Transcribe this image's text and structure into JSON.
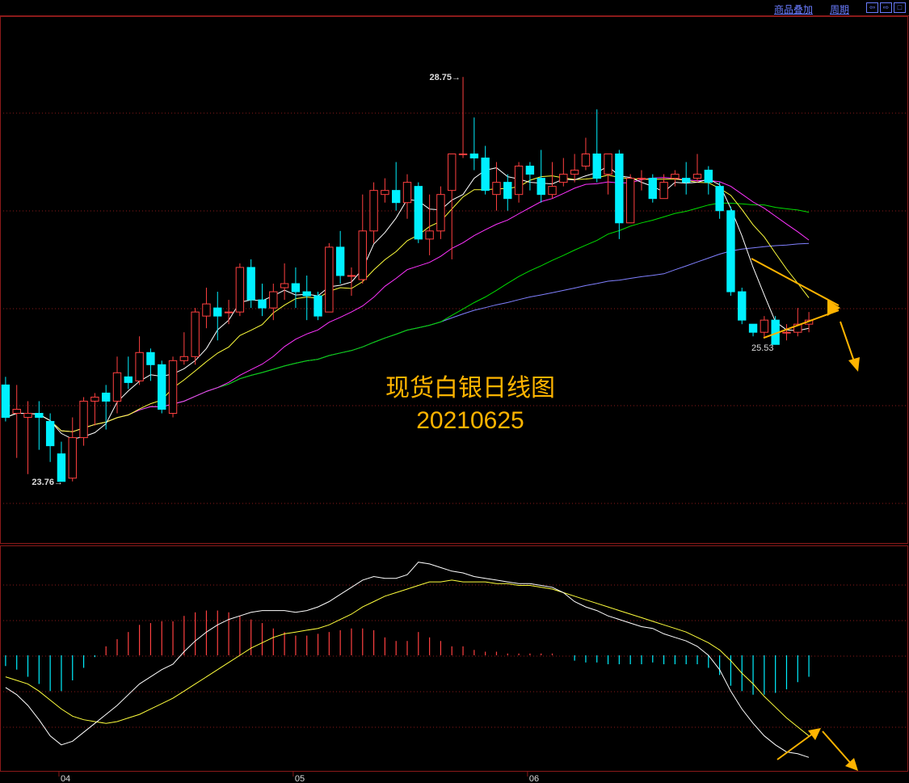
{
  "toolbar": {
    "overlay_label": "商品叠加",
    "period_label": "周期",
    "nav_icons": [
      "arrow-left-icon",
      "arrow-right-icon",
      "square-icon"
    ]
  },
  "colors": {
    "up": "#ff4040",
    "down": "#00f0ff",
    "ma5": "#ffffff",
    "ma10": "#ffff3c",
    "ma20": "#ff33ff",
    "ma40": "#00dd00",
    "ma60": "#8080ff",
    "grid": "#8b1a1a",
    "annotation": "#ffb400",
    "label": "#dddddd"
  },
  "chart_data": [
    {
      "type": "candlestick",
      "title": "现货白银日线图",
      "subtitle": "20210625",
      "x_tick_labels": [
        "04",
        "05",
        "06"
      ],
      "ylim": [
        23.0,
        29.5
      ],
      "high_marker": "28.75",
      "low_marker": "23.76",
      "annotation_low": "25.53",
      "candles": [
        [
          24.95,
          24.55,
          25.05,
          24.5
        ],
        [
          24.6,
          24.65,
          24.95,
          24.05
        ],
        [
          24.55,
          24.6,
          24.75,
          23.85
        ],
        [
          24.6,
          24.55,
          24.75,
          24.15
        ],
        [
          24.5,
          24.2,
          24.6,
          24.0
        ],
        [
          24.1,
          23.76,
          24.25,
          23.76
        ],
        [
          23.8,
          24.3,
          24.55,
          23.76
        ],
        [
          24.3,
          24.75,
          24.8,
          24.2
        ],
        [
          24.75,
          24.8,
          24.85,
          24.45
        ],
        [
          24.85,
          24.75,
          24.95,
          24.4
        ],
        [
          24.75,
          25.1,
          25.3,
          24.6
        ],
        [
          25.05,
          24.98,
          25.3,
          24.9
        ],
        [
          25.0,
          25.35,
          25.55,
          24.95
        ],
        [
          25.35,
          25.2,
          25.4,
          25.0
        ],
        [
          25.2,
          24.65,
          25.25,
          24.6
        ],
        [
          24.6,
          25.25,
          25.3,
          24.55
        ],
        [
          25.25,
          25.3,
          25.6,
          25.2
        ],
        [
          25.3,
          25.85,
          25.9,
          25.2
        ],
        [
          25.8,
          25.95,
          26.15,
          25.65
        ],
        [
          25.9,
          25.8,
          26.1,
          25.5
        ],
        [
          25.85,
          25.85,
          26.0,
          25.7
        ],
        [
          25.85,
          26.4,
          26.45,
          25.8
        ],
        [
          26.4,
          26.0,
          26.5,
          25.9
        ],
        [
          26.0,
          25.9,
          26.2,
          25.8
        ],
        [
          25.9,
          26.1,
          26.2,
          25.75
        ],
        [
          26.15,
          26.2,
          26.45,
          26.0
        ],
        [
          26.2,
          26.1,
          26.4,
          25.9
        ],
        [
          26.1,
          26.05,
          26.3,
          25.75
        ],
        [
          26.05,
          25.8,
          26.1,
          25.75
        ],
        [
          25.85,
          26.65,
          26.7,
          25.85
        ],
        [
          26.65,
          26.3,
          26.85,
          26.2
        ],
        [
          26.3,
          26.3,
          26.4,
          26.05
        ],
        [
          26.25,
          26.85,
          27.3,
          26.2
        ],
        [
          26.85,
          27.35,
          27.45,
          26.7
        ],
        [
          27.3,
          27.35,
          27.5,
          27.2
        ],
        [
          27.35,
          27.2,
          27.7,
          27.1
        ],
        [
          27.2,
          27.45,
          27.55,
          27.0
        ],
        [
          27.4,
          26.75,
          27.45,
          26.7
        ],
        [
          26.75,
          26.85,
          27.3,
          26.55
        ],
        [
          26.85,
          27.3,
          27.4,
          26.75
        ],
        [
          27.35,
          27.8,
          27.8,
          26.5
        ],
        [
          27.8,
          27.8,
          28.75,
          27.75
        ],
        [
          27.8,
          27.75,
          28.25,
          27.6
        ],
        [
          27.75,
          27.35,
          27.9,
          27.3
        ],
        [
          27.3,
          27.45,
          27.7,
          27.1
        ],
        [
          27.45,
          27.25,
          27.55,
          27.1
        ],
        [
          27.3,
          27.65,
          27.7,
          27.2
        ],
        [
          27.65,
          27.55,
          27.7,
          27.35
        ],
        [
          27.5,
          27.3,
          27.85,
          27.2
        ],
        [
          27.3,
          27.4,
          27.7,
          27.25
        ],
        [
          27.45,
          27.55,
          27.75,
          27.4
        ],
        [
          27.55,
          27.6,
          27.8,
          27.45
        ],
        [
          27.65,
          27.8,
          28.0,
          27.6
        ],
        [
          27.8,
          27.5,
          28.35,
          27.45
        ],
        [
          27.55,
          27.8,
          27.8,
          27.3
        ],
        [
          27.8,
          26.95,
          27.85,
          26.75
        ],
        [
          26.95,
          27.5,
          27.55,
          26.95
        ],
        [
          27.5,
          27.5,
          27.6,
          27.35
        ],
        [
          27.5,
          27.25,
          27.55,
          27.2
        ],
        [
          27.25,
          27.45,
          27.55,
          27.35
        ],
        [
          27.5,
          27.55,
          27.6,
          27.4
        ],
        [
          27.5,
          27.45,
          27.7,
          27.3
        ],
        [
          27.5,
          27.55,
          27.8,
          27.45
        ],
        [
          27.6,
          27.45,
          27.65,
          27.3
        ],
        [
          27.4,
          27.1,
          27.45,
          27.0
        ],
        [
          27.1,
          26.1,
          27.15,
          26.05
        ],
        [
          26.1,
          25.75,
          26.15,
          25.7
        ],
        [
          25.7,
          25.6,
          25.7,
          25.55
        ],
        [
          25.6,
          25.75,
          25.8,
          25.53
        ],
        [
          25.75,
          25.45,
          25.8,
          25.45
        ],
        [
          25.6,
          25.6,
          25.7,
          25.5
        ],
        [
          25.6,
          25.7,
          25.9,
          25.55
        ],
        [
          25.7,
          25.75,
          25.85,
          25.6
        ]
      ]
    },
    {
      "type": "bar-line",
      "indicator": "MACD",
      "x_tick_labels": [
        "04",
        "05",
        "06"
      ],
      "ylim": [
        -0.65,
        0.6
      ],
      "dif": [
        -0.18,
        -0.22,
        -0.28,
        -0.36,
        -0.45,
        -0.5,
        -0.48,
        -0.43,
        -0.38,
        -0.33,
        -0.28,
        -0.22,
        -0.16,
        -0.12,
        -0.08,
        -0.05,
        0.02,
        0.08,
        0.13,
        0.17,
        0.2,
        0.22,
        0.24,
        0.25,
        0.25,
        0.25,
        0.24,
        0.25,
        0.27,
        0.3,
        0.34,
        0.38,
        0.42,
        0.44,
        0.43,
        0.43,
        0.45,
        0.52,
        0.51,
        0.49,
        0.47,
        0.46,
        0.44,
        0.43,
        0.42,
        0.41,
        0.4,
        0.4,
        0.39,
        0.38,
        0.35,
        0.3,
        0.27,
        0.25,
        0.22,
        0.2,
        0.18,
        0.16,
        0.15,
        0.12,
        0.1,
        0.08,
        0.05,
        0.0,
        -0.08,
        -0.2,
        -0.3,
        -0.38,
        -0.45,
        -0.5,
        -0.54,
        -0.55,
        -0.57
      ],
      "dea": [
        -0.12,
        -0.14,
        -0.16,
        -0.2,
        -0.25,
        -0.3,
        -0.34,
        -0.36,
        -0.37,
        -0.38,
        -0.37,
        -0.35,
        -0.33,
        -0.3,
        -0.27,
        -0.24,
        -0.2,
        -0.16,
        -0.12,
        -0.08,
        -0.04,
        0.0,
        0.04,
        0.07,
        0.1,
        0.12,
        0.13,
        0.14,
        0.15,
        0.17,
        0.2,
        0.23,
        0.27,
        0.3,
        0.33,
        0.35,
        0.37,
        0.39,
        0.41,
        0.41,
        0.42,
        0.41,
        0.41,
        0.41,
        0.4,
        0.4,
        0.39,
        0.39,
        0.38,
        0.37,
        0.35,
        0.33,
        0.31,
        0.29,
        0.27,
        0.25,
        0.23,
        0.21,
        0.19,
        0.17,
        0.15,
        0.13,
        0.1,
        0.07,
        0.03,
        -0.03,
        -0.1,
        -0.16,
        -0.23,
        -0.29,
        -0.35,
        -0.4,
        -0.45
      ],
      "hist": [
        -0.06,
        -0.08,
        -0.12,
        -0.16,
        -0.2,
        -0.2,
        -0.14,
        -0.07,
        -0.01,
        0.05,
        0.09,
        0.13,
        0.17,
        0.18,
        0.19,
        0.19,
        0.22,
        0.24,
        0.25,
        0.25,
        0.24,
        0.22,
        0.2,
        0.18,
        0.15,
        0.13,
        0.11,
        0.11,
        0.12,
        0.13,
        0.14,
        0.15,
        0.15,
        0.14,
        0.1,
        0.08,
        0.08,
        0.13,
        0.1,
        0.08,
        0.05,
        0.05,
        0.03,
        0.02,
        0.02,
        0.01,
        0.01,
        0.01,
        0.01,
        0.01,
        0.0,
        -0.03,
        -0.04,
        -0.04,
        -0.05,
        -0.05,
        -0.05,
        -0.05,
        -0.04,
        -0.05,
        -0.05,
        -0.05,
        -0.05,
        -0.07,
        -0.11,
        -0.17,
        -0.2,
        -0.22,
        -0.22,
        -0.21,
        -0.19,
        -0.15,
        -0.12
      ]
    }
  ]
}
